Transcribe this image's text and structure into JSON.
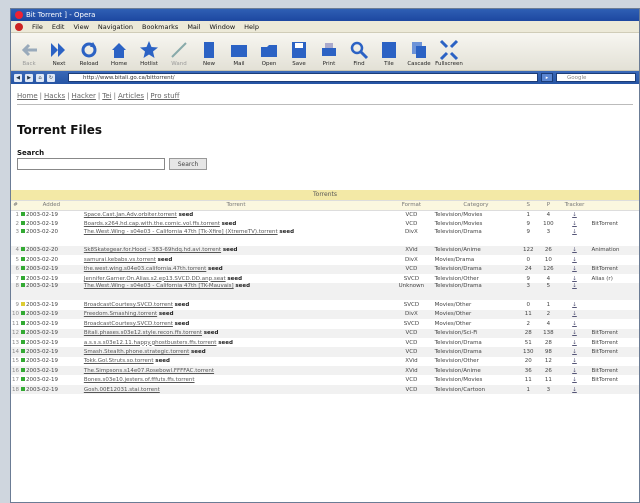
{
  "window": {
    "title": "Bit Torrent ] - Opera"
  },
  "menu": [
    "File",
    "Edit",
    "View",
    "Navigation",
    "Bookmarks",
    "Mail",
    "Window",
    "Help"
  ],
  "toolbar": [
    {
      "label": "Back",
      "icon": "back-icon",
      "disabled": true
    },
    {
      "label": "Next",
      "icon": "next-icon",
      "disabled": false
    },
    {
      "label": "Reload",
      "icon": "reload-icon",
      "disabled": false
    },
    {
      "label": "Home",
      "icon": "home-icon",
      "disabled": false
    },
    {
      "label": "Hotlist",
      "icon": "star-icon",
      "disabled": false
    },
    {
      "label": "Wand",
      "icon": "wand-icon",
      "disabled": true
    },
    {
      "label": "New",
      "icon": "new-page-icon",
      "disabled": false
    },
    {
      "label": "Mail",
      "icon": "mail-icon",
      "disabled": false
    },
    {
      "label": "Open",
      "icon": "folder-icon",
      "disabled": false
    },
    {
      "label": "Save",
      "icon": "save-icon",
      "disabled": false
    },
    {
      "label": "Print",
      "icon": "print-icon",
      "disabled": false
    },
    {
      "label": "Find",
      "icon": "find-icon",
      "disabled": false
    },
    {
      "label": "Tile",
      "icon": "tile-icon",
      "disabled": false
    },
    {
      "label": "Cascade",
      "icon": "cascade-icon",
      "disabled": false
    },
    {
      "label": "Fullscreen",
      "icon": "fullscreen-icon",
      "disabled": false
    }
  ],
  "address": {
    "url": "http://www.bitali.go.ca/bittorrent/",
    "search_placeholder": "Google"
  },
  "sitenav": [
    "Home",
    "Hacks",
    "Hacker",
    "Tei",
    "Articles",
    "Pro stuff"
  ],
  "page": {
    "title": "Torrent Files",
    "search_label": "Search",
    "search_button": "Search"
  },
  "table": {
    "caption": "Torrents",
    "headers": [
      "#",
      "Added",
      "Torrent",
      "Format",
      "Category",
      "S",
      "P",
      "Tracker",
      ""
    ],
    "rows": [
      {
        "idx": "1",
        "added": "2003-02-19",
        "name": "Space.Cast.Jan.Adv.orbiter.torrent",
        "tag": "seed",
        "format": "VCD",
        "category": "Television/Movies",
        "s": "1",
        "p": "4",
        "tracker": "↓",
        "extra": "",
        "alt": false,
        "tall": false
      },
      {
        "idx": "2",
        "added": "2003-02-19",
        "name": "Boards.x264.hd.cap.with.the.comic.vol.ffs.torrent",
        "tag": "seed",
        "format": "VCD",
        "category": "Television/Movies",
        "s": "9",
        "p": "100",
        "tracker": "↓",
        "extra": "BitTorrent",
        "alt": false,
        "tall": false
      },
      {
        "idx": "3",
        "added": "2003-02-20",
        "name": "The.West.Wing - s04e03 - California 47th [Tk-Xfire] (XtremeTV).torrent",
        "tag": "seed",
        "format": "DivX",
        "category": "Television/Drama",
        "s": "9",
        "p": "3",
        "tracker": "↓",
        "extra": "",
        "alt": false,
        "tall": true
      },
      {
        "idx": "4",
        "added": "2003-02-20",
        "name": "Sk8Skategear.for.Hood - 383-69hdq.hd.avi.torrent",
        "tag": "seed",
        "format": "XVid",
        "category": "Television/Anime",
        "s": "122",
        "p": "26",
        "tracker": "↓",
        "extra": "Animation",
        "alt": true,
        "tall": false
      },
      {
        "idx": "5",
        "added": "2003-02-20",
        "name": "samurai.kebabs.vs.torrent",
        "tag": "seed",
        "format": "DivX",
        "category": "Movies/Drama",
        "s": "0",
        "p": "10",
        "tracker": "↓",
        "extra": "",
        "alt": false,
        "tall": false
      },
      {
        "idx": "6",
        "added": "2003-02-19",
        "name": "the.west.wing.s04e03.california.47th.torrent",
        "tag": "seed",
        "format": "VCD",
        "category": "Television/Drama",
        "s": "24",
        "p": "126",
        "tracker": "↓",
        "extra": "BitTorrent",
        "alt": true,
        "tall": false
      },
      {
        "idx": "7",
        "added": "2003-02-19",
        "name": "Jennifer.Garner.On.Alias.s2.ep13.SVCD.DD.anp.seat",
        "tag": "seed",
        "format": "SVCD",
        "category": "Television/Other",
        "s": "9",
        "p": "4",
        "tracker": "↓",
        "extra": "Alias (r)",
        "alt": false,
        "tall": false
      },
      {
        "idx": "8",
        "added": "2003-02-19",
        "name": "The.West.Wing - s04e03 - California 47th [TK-Mauvais]",
        "tag": "seed",
        "format": "Unknown",
        "category": "Television/Drama",
        "s": "3",
        "p": "5",
        "tracker": "↓",
        "extra": "",
        "alt": true,
        "tall": true
      },
      {
        "idx": "9",
        "added": "2003-02-19",
        "name": "BroadcastCourtesy.SVCD.torrent",
        "tag": "seed",
        "format": "SVCD",
        "category": "Movies/Other",
        "s": "0",
        "p": "1",
        "tracker": "↓",
        "extra": "",
        "alt": false,
        "tall": false
      },
      {
        "idx": "10",
        "added": "2003-02-19",
        "name": "Freedom.Smashing.torrent",
        "tag": "seed",
        "format": "DivX",
        "category": "Movies/Other",
        "s": "11",
        "p": "2",
        "tracker": "↓",
        "extra": "",
        "alt": true,
        "tall": false
      },
      {
        "idx": "11",
        "added": "2003-02-19",
        "name": "BroadcastCourtesy.SVCD.torrent",
        "tag": "seed",
        "format": "SVCD",
        "category": "Movies/Other",
        "s": "2",
        "p": "4",
        "tracker": "↓",
        "extra": "",
        "alt": false,
        "tall": false
      },
      {
        "idx": "12",
        "added": "2003-02-19",
        "name": "Bitali.phases.s03e12.style.recon.ffs.torrent",
        "tag": "seed",
        "format": "VCD",
        "category": "Television/Sci-Fi",
        "s": "28",
        "p": "138",
        "tracker": "↓",
        "extra": "BitTorrent",
        "alt": true,
        "tall": false
      },
      {
        "idx": "13",
        "added": "2003-02-19",
        "name": "a.s.s.s.s03e12.11.happy.ghostbusters.ffs.torrent",
        "tag": "seed",
        "format": "VCD",
        "category": "Television/Drama",
        "s": "51",
        "p": "28",
        "tracker": "↓",
        "extra": "BitTorrent",
        "alt": false,
        "tall": false
      },
      {
        "idx": "14",
        "added": "2003-02-19",
        "name": "Smash.Stealth.phone.strategic.torrent",
        "tag": "seed",
        "format": "VCD",
        "category": "Television/Drama",
        "s": "130",
        "p": "98",
        "tracker": "↓",
        "extra": "BitTorrent",
        "alt": true,
        "tall": false
      },
      {
        "idx": "15",
        "added": "2003-02-19",
        "name": "Tokk.Gol.Struts.so.torrent",
        "tag": "seed",
        "format": "XVid",
        "category": "Television/Other",
        "s": "20",
        "p": "12",
        "tracker": "↓",
        "extra": "",
        "alt": false,
        "tall": false
      },
      {
        "idx": "16",
        "added": "2003-02-19",
        "name": "The.Simpsons.s14e07.Rosebowl.FFFFAC.torrent",
        "tag": "",
        "format": "XVid",
        "category": "Television/Anime",
        "s": "36",
        "p": "26",
        "tracker": "↓",
        "extra": "BitTorrent",
        "alt": true,
        "tall": false
      },
      {
        "idx": "17",
        "added": "2003-02-19",
        "name": "Bones.s03e10.jesters.of.fffuts.ffs.torrent",
        "tag": "",
        "format": "VCD",
        "category": "Television/Movies",
        "s": "11",
        "p": "11",
        "tracker": "↓",
        "extra": "BitTorrent",
        "alt": false,
        "tall": false
      },
      {
        "idx": "18",
        "added": "2003-02-19",
        "name": "Gosh.00E12031.stai.torrent",
        "tag": "",
        "format": "VCD",
        "category": "Television/Cartoon",
        "s": "1",
        "p": "3",
        "tracker": "↓",
        "extra": "",
        "alt": true,
        "tall": false
      }
    ]
  },
  "colors": {
    "titlebar": "#1d47a0",
    "caption_band": "#f3e9a6",
    "header_band": "#fbf7df",
    "seed_dot": "#33aa33",
    "alt_row": "#f1f1f1"
  }
}
